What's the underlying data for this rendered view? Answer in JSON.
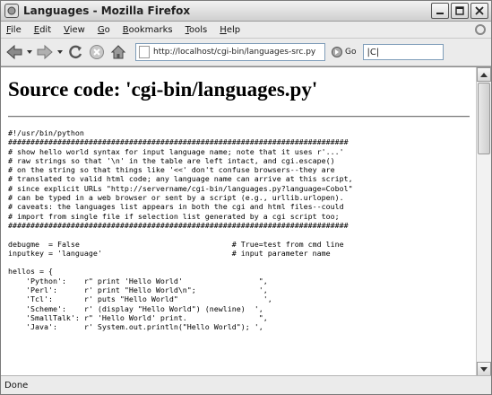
{
  "window": {
    "title": "Languages - Mozilla Firefox",
    "icons": [
      "firefox-icon",
      "minimize-icon",
      "maximize-icon",
      "close-icon"
    ]
  },
  "menubar": {
    "items": [
      {
        "u": "F",
        "rest": "ile"
      },
      {
        "u": "E",
        "rest": "dit"
      },
      {
        "u": "V",
        "rest": "iew"
      },
      {
        "u": "G",
        "rest": "o"
      },
      {
        "u": "B",
        "rest": "ookmarks"
      },
      {
        "u": "T",
        "rest": "ools"
      },
      {
        "u": "H",
        "rest": "elp"
      }
    ]
  },
  "navbar": {
    "url": "http://localhost/cgi-bin/languages-src.py",
    "go_label": "Go",
    "search_value": "|C|"
  },
  "page": {
    "title": "Source code: 'cgi-bin/languages.py'",
    "code": "#!/usr/bin/python\n############################################################################\n# show hello world syntax for input language name; note that it uses r'...'\n# raw strings so that '\\n' in the table are left intact, and cgi.escape()\n# on the string so that things like '<<' don't confuse browsers--they are\n# translated to valid html code; any language name can arrive at this script,\n# since explicit URLs \"http://servername/cgi-bin/languages.py?language=Cobol\"\n# can be typed in a web browser or sent by a script (e.g., urllib.urlopen).\n# caveats: the languages list appears in both the cgi and html files--could\n# import from single file if selection list generated by a cgi script too;\n############################################################################\n\ndebugme  = False                                  # True=test from cmd line\ninputkey = 'language'                             # input parameter name\n\nhellos = {\n    'Python':    r\" print 'Hello World'                 \",\n    'Perl':      r' print \"Hello World\\n\";              ',\n    'Tcl':       r' puts \"Hello World\"                   ',\n    'Scheme':    r' (display \"Hello World\") (newline)  ',\n    'SmallTalk': r\" 'Hello World' print.                \",\n    'Java':      r' System.out.println(\"Hello World\"); ',"
  },
  "status": {
    "text": "Done"
  }
}
